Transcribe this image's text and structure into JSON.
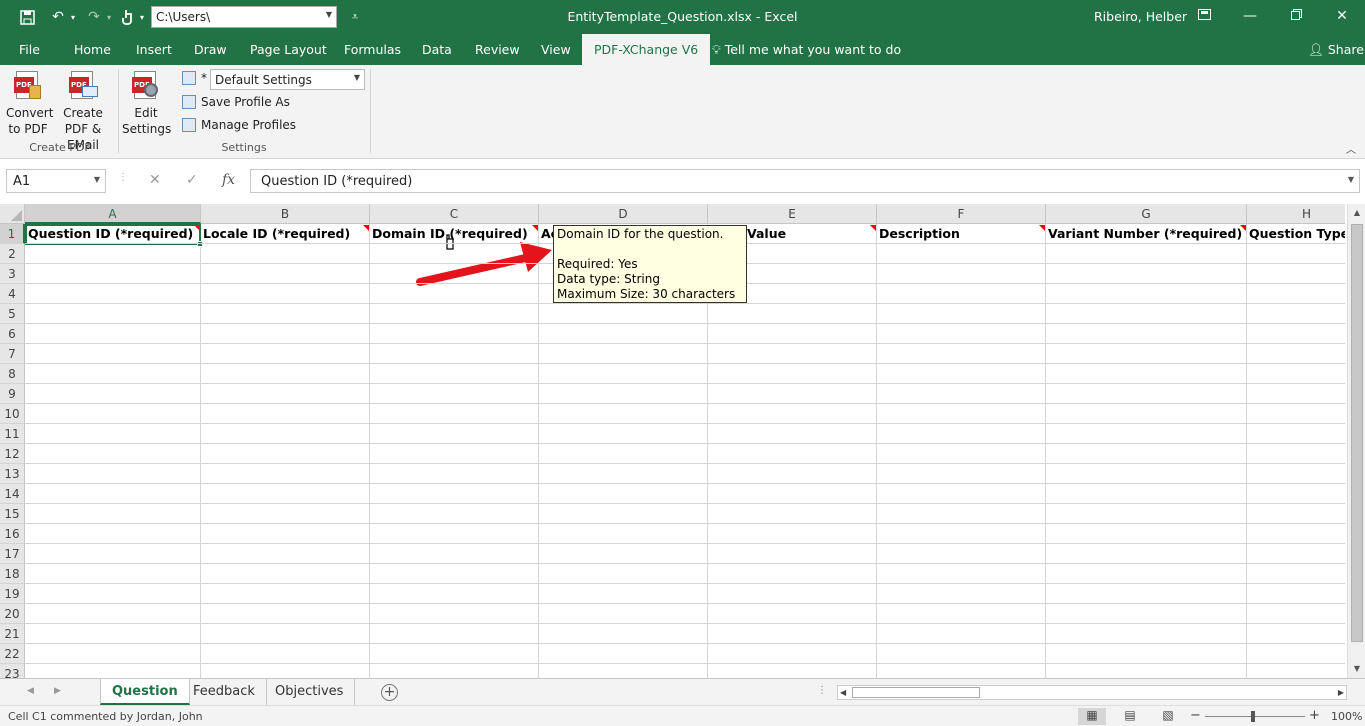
{
  "titlebar": {
    "path": "C:\\Users\\",
    "title": "EntityTemplate_Question.xlsx  -  Excel",
    "user": "Ribeiro, Helber"
  },
  "tabs": [
    "File",
    "Home",
    "Insert",
    "Draw",
    "Page Layout",
    "Formulas",
    "Data",
    "Review",
    "View",
    "PDF-XChange V6"
  ],
  "active_tab": "PDF-XChange V6",
  "tell_me": "Tell me what you want to do",
  "share": "Share",
  "ribbon": {
    "convert_to_pdf": "Convert to PDF",
    "create_pdf_email": "Create PDF & EMail",
    "create_pdf_group": "Create PDF",
    "edit_settings": "Edit Settings",
    "profile_asterisk": "*",
    "profile": "Default Settings",
    "save_profile_as": "Save Profile As",
    "manage_profiles": "Manage Profiles",
    "settings_group": "Settings"
  },
  "formula_bar": {
    "name_box": "A1",
    "fx": "fx",
    "value": "Question ID (*required)"
  },
  "columns": [
    "A",
    "B",
    "C",
    "D",
    "E",
    "F",
    "G",
    "H"
  ],
  "rows": [
    "1",
    "2",
    "3",
    "4",
    "5",
    "6",
    "7",
    "8",
    "9",
    "10",
    "11",
    "12",
    "13",
    "14",
    "15",
    "16",
    "17",
    "18",
    "19",
    "20",
    "21",
    "22",
    "23"
  ],
  "header_cells": {
    "a": "Question ID (*required)",
    "b": "Locale ID (*required)",
    "c": "Domain ID (*required)",
    "d": "Ac",
    "e": "Value",
    "f": "Description",
    "g": "Variant Number (*required)",
    "h": "Question Type (*"
  },
  "comment": {
    "line1": "Domain ID for the question.",
    "line2": "Required: Yes",
    "line3": "Data type: String",
    "line4": "Maximum Size: 30 characters"
  },
  "sheets": [
    "Question",
    "Feedback",
    "Objectives"
  ],
  "active_sheet": "Question",
  "status": {
    "text": "Cell C1 commented by Jordan, John",
    "zoom": "100%",
    "zoom_percent": 100
  },
  "colors": {
    "excel_green": "#217346",
    "comment_bg": "#ffffe1",
    "comment_marker": "#ee0000",
    "arrow": "#e3141c"
  }
}
